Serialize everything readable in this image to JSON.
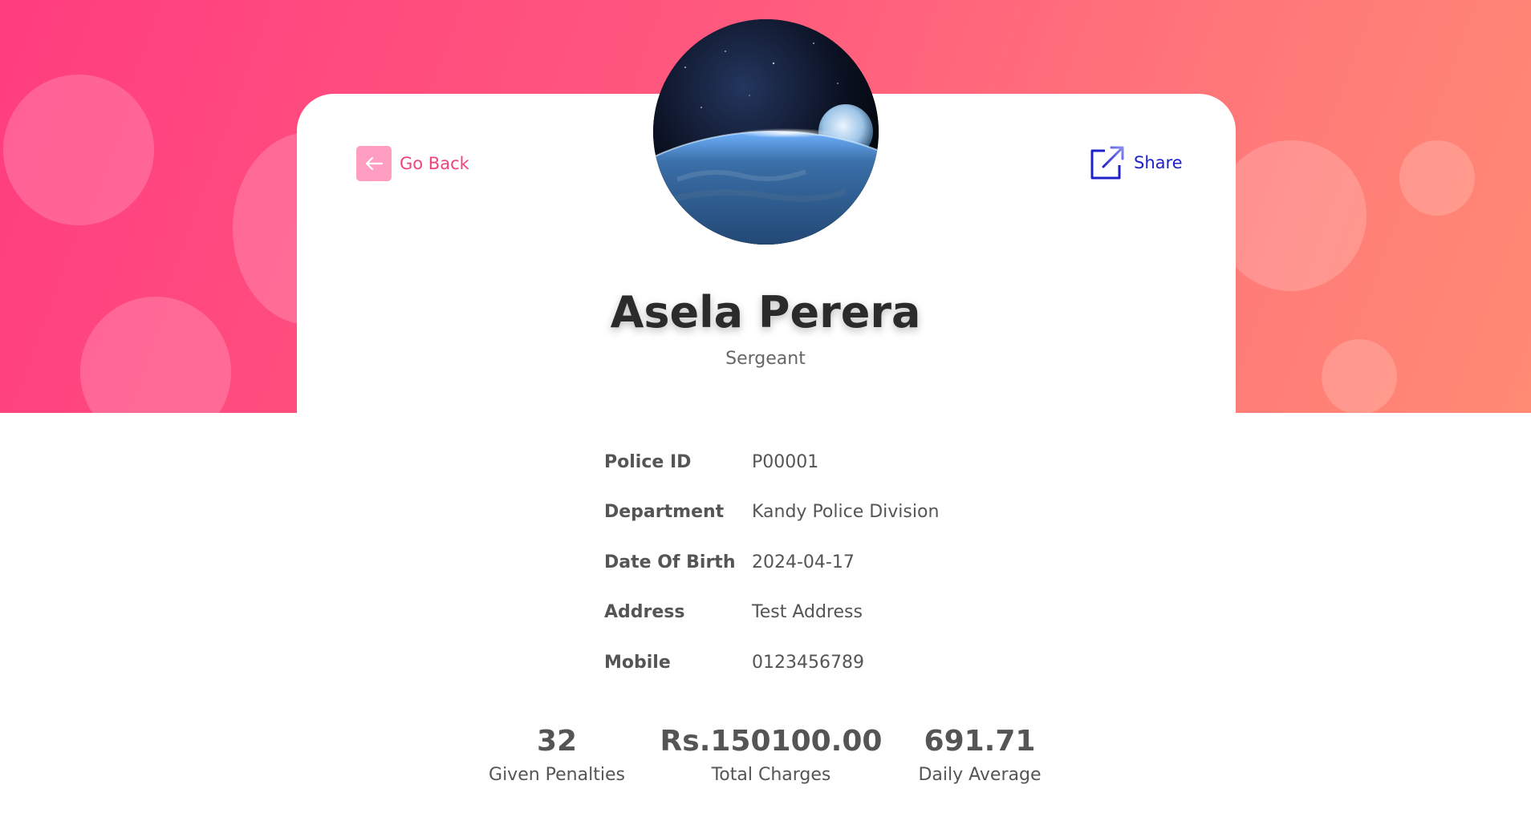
{
  "nav": {
    "back_label": "Go Back",
    "share_label": "Share"
  },
  "profile": {
    "name": "Asela Perera",
    "rank": "Sergeant",
    "avatar_icon": "earth-from-space-image"
  },
  "details": [
    {
      "label": "Police ID",
      "value": "P00001"
    },
    {
      "label": "Department",
      "value": "Kandy Police Division"
    },
    {
      "label": "Date Of Birth",
      "value": "2024-04-17"
    },
    {
      "label": "Address",
      "value": "Test Address"
    },
    {
      "label": "Mobile",
      "value": "0123456789"
    }
  ],
  "stats": [
    {
      "value": "32",
      "label": "Given Penalties"
    },
    {
      "value": "Rs.150100.00",
      "label": "Total Charges"
    },
    {
      "value": "691.71",
      "label": "Daily Average"
    }
  ],
  "colors": {
    "hero_start": "#ff3d7f",
    "hero_end": "#ff8a73",
    "back_accent": "#f0437c",
    "share_accent": "#1e21c8",
    "text": "#555555"
  }
}
